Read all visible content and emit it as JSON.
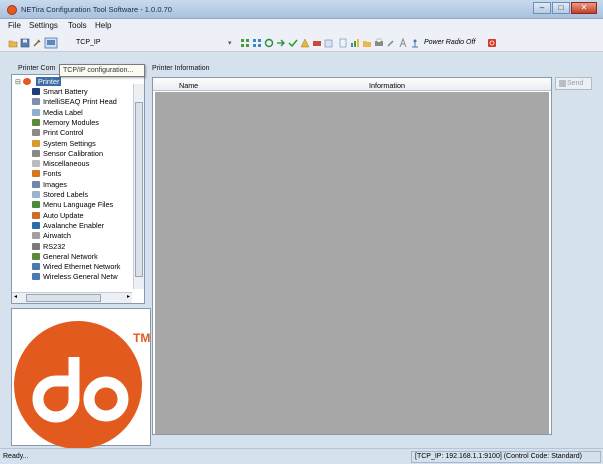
{
  "window": {
    "title": "NETira Configuration Tool Software - 1.0.0.70"
  },
  "menu": {
    "file": "File",
    "settings": "Settings",
    "tools": "Tools",
    "help": "Help"
  },
  "toolbar": {
    "connection_label": "TCP_IP",
    "power_radio": "Power Radio Off"
  },
  "tooltip": "TCP/IP configuration...",
  "left_panel": {
    "label": "Printer Com",
    "root_label": "Printer",
    "items": [
      {
        "label": "Smart Battery",
        "icon": "battery-icon",
        "color": "#1e3c78"
      },
      {
        "label": "IntelliSEAQ Print Head",
        "icon": "printhead-icon",
        "color": "#7f8fa8"
      },
      {
        "label": "Media Label",
        "icon": "media-label-icon",
        "color": "#8fb0d0"
      },
      {
        "label": "Memory Modules",
        "icon": "memory-icon",
        "color": "#5d8a3a"
      },
      {
        "label": "Print Control",
        "icon": "print-control-icon",
        "color": "#8a8a8a"
      },
      {
        "label": "System Settings",
        "icon": "system-settings-icon",
        "color": "#d89a2a"
      },
      {
        "label": "Sensor Calibration",
        "icon": "sensor-icon",
        "color": "#888888"
      },
      {
        "label": "Miscellaneous",
        "icon": "misc-icon",
        "color": "#bcbcbc"
      },
      {
        "label": "Fonts",
        "icon": "fonts-icon",
        "color": "#d8761c"
      },
      {
        "label": "Images",
        "icon": "images-icon",
        "color": "#6f88a8"
      },
      {
        "label": "Stored Labels",
        "icon": "stored-labels-icon",
        "color": "#9ab2cc"
      },
      {
        "label": "Menu Language Files",
        "icon": "language-icon",
        "color": "#4d8a3a"
      },
      {
        "label": "Auto Update",
        "icon": "auto-update-icon",
        "color": "#cf6a2a"
      },
      {
        "label": "Avalanche Enabler",
        "icon": "avalanche-icon",
        "color": "#2c6cae"
      },
      {
        "label": "Airwatch",
        "icon": "airwatch-icon",
        "color": "#a0a0a0"
      },
      {
        "label": "RS232",
        "icon": "rs232-icon",
        "color": "#7a7a7a"
      },
      {
        "label": "General Network",
        "icon": "network-icon",
        "color": "#5a8a3a"
      },
      {
        "label": "Wired Ethernet Network",
        "icon": "ethernet-icon",
        "color": "#4a78b0"
      },
      {
        "label": "Wireless General Netw",
        "icon": "wireless-icon",
        "color": "#4a78b0"
      }
    ]
  },
  "right_panel": {
    "label": "Printer Information",
    "col_name": "Name",
    "col_information": "Information",
    "send_label": "Send"
  },
  "status": {
    "left": "Ready...",
    "right": "[TCP_IP: 192.168.1.1:9100] (Control Code: Standard)"
  },
  "brand": {
    "logo_tm": "TM",
    "logo_color": "#e35a1e"
  }
}
